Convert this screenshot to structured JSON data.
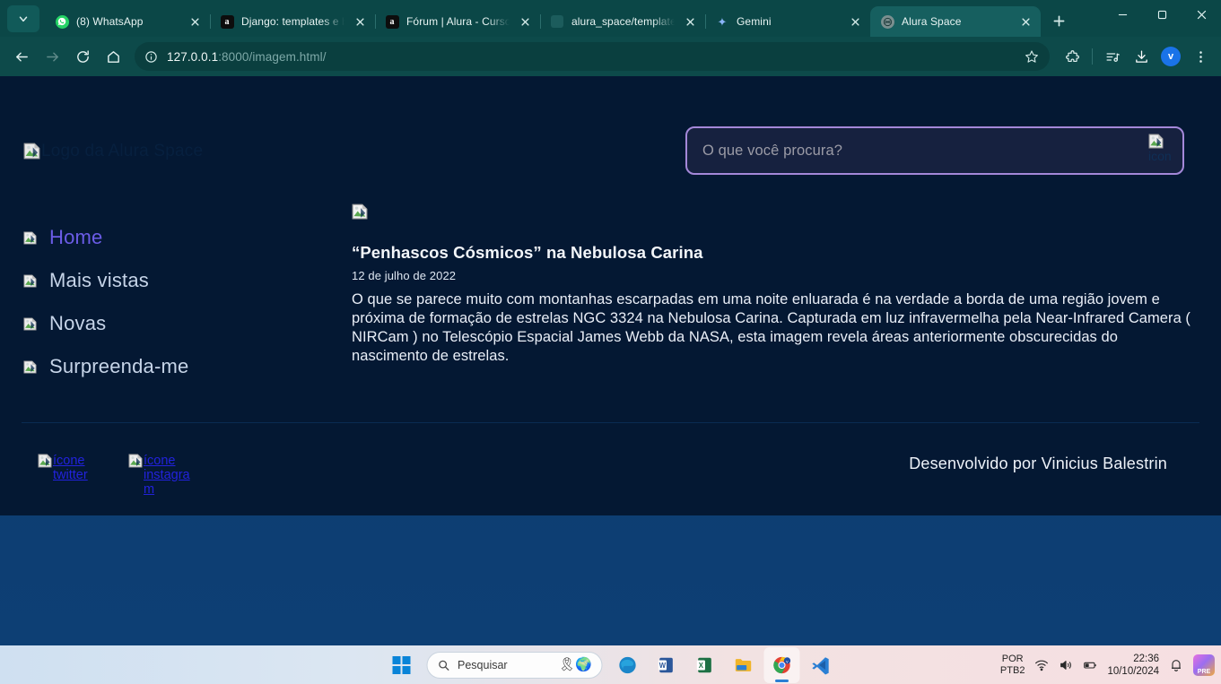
{
  "browser": {
    "tabs": [
      {
        "title": "(8) WhatsApp",
        "favicon": "whatsapp-icon",
        "active": false
      },
      {
        "title": "Django: templates e b",
        "favicon": "alura-icon",
        "active": false
      },
      {
        "title": "Fórum | Alura - Curso",
        "favicon": "alura-icon",
        "active": false
      },
      {
        "title": "alura_space/templates",
        "favicon": "generic-icon",
        "active": false
      },
      {
        "title": "Gemini",
        "favicon": "gemini-icon",
        "active": false
      },
      {
        "title": "Alura Space",
        "favicon": "alura-space-icon",
        "active": true
      }
    ],
    "new_tab_label": "+",
    "url_host": "127.0.0.1",
    "url_path": ":8000/imagem.html/",
    "profile_initial": "v",
    "toolbar_icons": [
      "back-icon",
      "forward-icon",
      "reload-icon",
      "home-icon",
      "site-info-icon",
      "bookmark-star-icon",
      "extensions-icon",
      "media-control-icon",
      "downloads-icon",
      "profile-avatar",
      "chrome-menu-icon"
    ],
    "window_controls": [
      "minimize-icon",
      "maximize-icon",
      "close-icon"
    ]
  },
  "page": {
    "logo_alt": "Logo da Alura Space",
    "search": {
      "placeholder": "O que você procura?",
      "value": "",
      "icon_alt": "icon"
    },
    "nav": [
      {
        "label": "Home",
        "icon_alt": "",
        "active": true
      },
      {
        "label": "Mais vistas",
        "icon_alt": "",
        "active": false
      },
      {
        "label": "Novas",
        "icon_alt": "",
        "active": false
      },
      {
        "label": "Surpreenda-me",
        "icon_alt": "",
        "active": false
      }
    ],
    "article": {
      "image_alt": "",
      "title": "“Penhascos Cósmicos” na Nebulosa Carina",
      "date": "12 de julho de 2022",
      "text": "O que se parece muito com montanhas escarpadas em uma noite enluarada é na verdade a borda de uma região jovem e próxima de formação de estrelas NGC 3324 na Nebulosa Carina. Capturada em luz infravermelha pela Near-Infrared Camera ( NIRCam ) no Telescópio Espacial James Webb da NASA, esta imagem revela áreas anteriormente obscurecidas do nascimento de estrelas."
    },
    "footer": {
      "social": [
        {
          "alt": "ícone twitter"
        },
        {
          "alt": "ícone instagram"
        }
      ],
      "credit": "Desenvolvido por Vinicius Balestrin"
    },
    "colors": {
      "background": "#041833",
      "accent_active_nav": "#6b5ce7",
      "search_border": "#a488d9",
      "link": "#2222dd"
    }
  },
  "taskbar": {
    "search_placeholder": "Pesquisar",
    "apps": [
      "start-icon",
      "edge-icon",
      "word-icon",
      "excel-icon",
      "file-explorer-icon",
      "chrome-icon",
      "vscode-icon"
    ],
    "tray": {
      "language_line1": "POR",
      "language_line2": "PTB2",
      "icons": [
        "wifi-icon",
        "volume-icon",
        "battery-icon",
        "notification-bell-icon",
        "copilot-icon"
      ],
      "time": "22:36",
      "date": "10/10/2024",
      "copilot_label": "PRE"
    }
  }
}
